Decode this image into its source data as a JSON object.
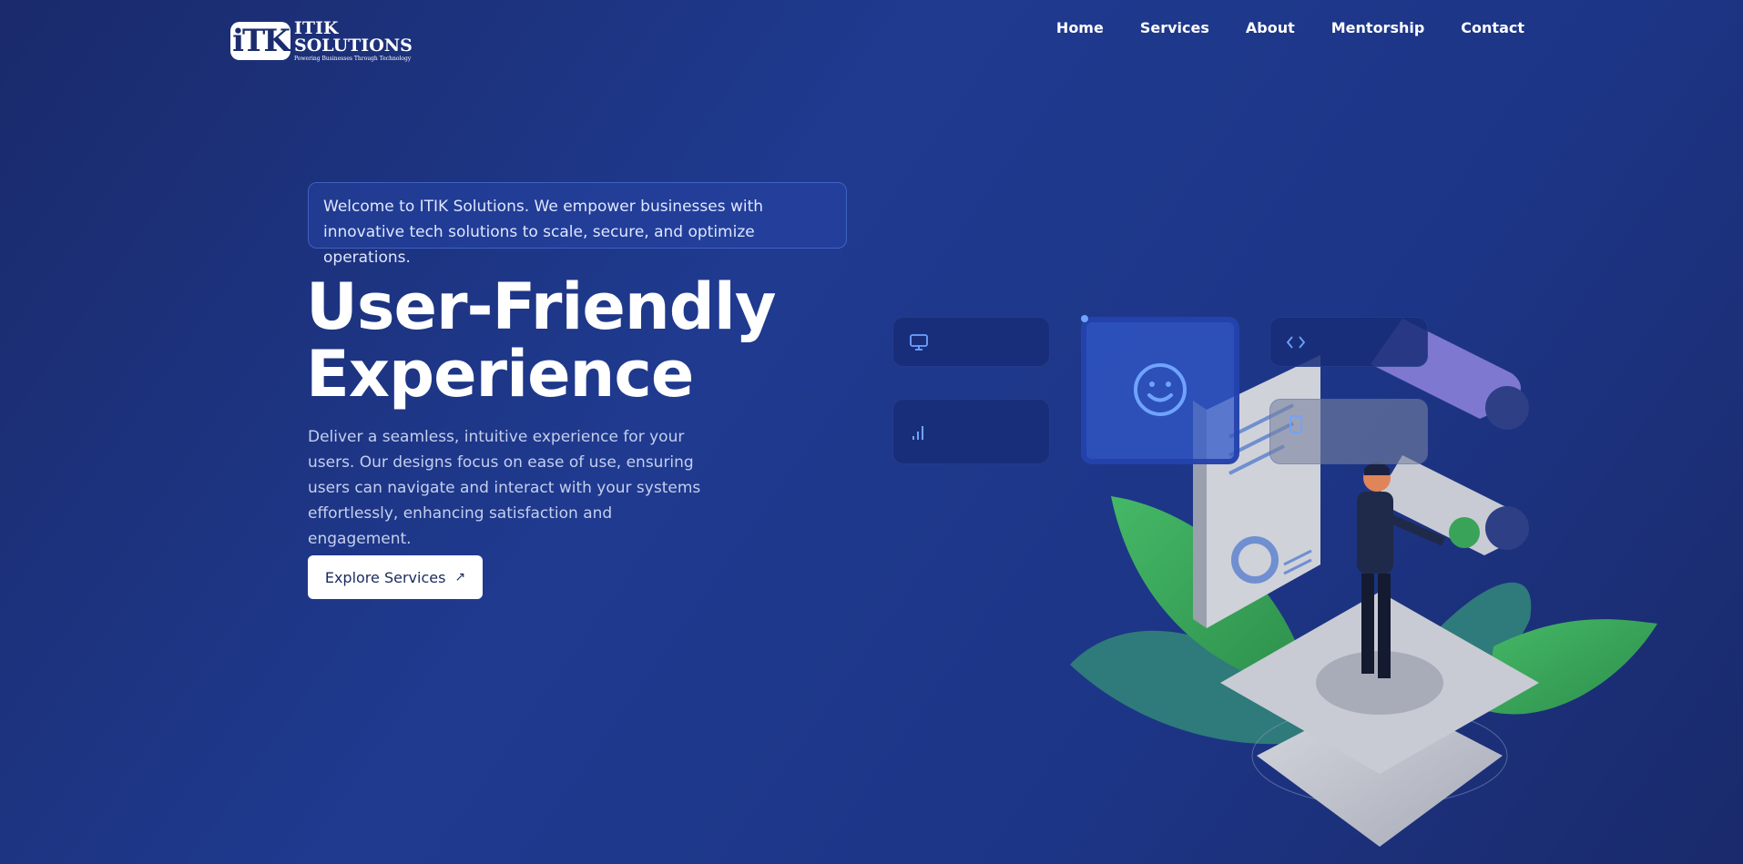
{
  "logo": {
    "mark": "iTK",
    "name_line1": "ITIK",
    "name_line2": "SOLUTIONS",
    "tagline": "Powering Businesses Through Technology"
  },
  "nav": {
    "items": [
      "Home",
      "Services",
      "About",
      "Mentorship",
      "Contact"
    ]
  },
  "hero": {
    "welcome": "Welcome to ITIK Solutions. We empower businesses with innovative tech solutions to scale, secure, and optimize operations.",
    "headline_line1": "User-Friendly",
    "headline_line2": "Experience",
    "description": "Deliver a seamless, intuitive experience for your users. Our designs focus on ease of use, ensuring users can navigate and interact with your systems effortlessly, enhancing satisfaction and engagement.",
    "cta_label": "Explore Services",
    "cta_icon": "arrow-up-right-icon"
  },
  "cards": {
    "icons": [
      "monitor-icon",
      "bar-chart-icon",
      "smiley-icon",
      "code-icon",
      "tablet-icon"
    ]
  },
  "colors": {
    "background": "#1f3a8f",
    "accent": "#6fa3ff",
    "leaf_green": "#3aa35a",
    "leaf_teal": "#2f7a7a"
  }
}
